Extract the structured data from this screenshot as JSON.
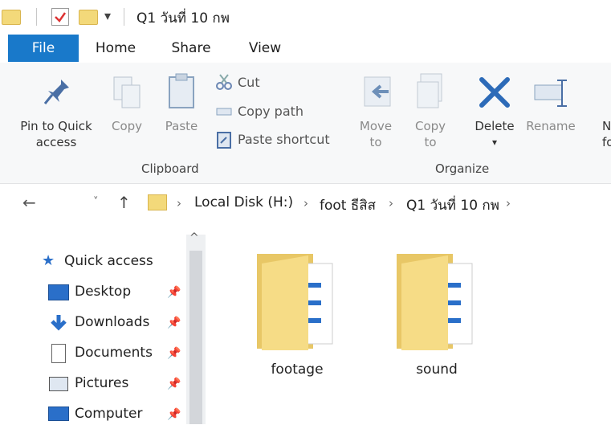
{
  "window": {
    "title": "Q1 วันที่ 10 กพ"
  },
  "tabs": [
    {
      "label": "File",
      "active": true
    },
    {
      "label": "Home"
    },
    {
      "label": "Share"
    },
    {
      "label": "View"
    }
  ],
  "ribbon": {
    "clipboard": {
      "group_label": "Clipboard",
      "pin_label_line1": "Pin to Quick",
      "pin_label_line2": "access",
      "copy_label": "Copy",
      "paste_label": "Paste",
      "cut_label": "Cut",
      "copy_path_label": "Copy path",
      "paste_shortcut_label": "Paste shortcut"
    },
    "organize": {
      "group_label": "Organize",
      "move_to_line1": "Move",
      "move_to_line2": "to",
      "copy_to_line1": "Copy",
      "copy_to_line2": "to",
      "delete_label": "Delete",
      "rename_label": "Rename",
      "new_folder_partial_line1": "N",
      "new_folder_partial_line2": "fo"
    }
  },
  "address": {
    "crumbs": [
      "Local Disk (H:)",
      "foot ธีสิส",
      "Q1 วันที่ 10 กพ"
    ]
  },
  "sidebar": {
    "items": [
      {
        "label": "Quick access",
        "icon": "star-icon",
        "pinned": false
      },
      {
        "label": "Desktop",
        "icon": "desktop-icon",
        "pinned": true
      },
      {
        "label": "Downloads",
        "icon": "download-icon",
        "pinned": true
      },
      {
        "label": "Documents",
        "icon": "documents-icon",
        "pinned": true
      },
      {
        "label": "Pictures",
        "icon": "pictures-icon",
        "pinned": true
      },
      {
        "label": "Computer",
        "icon": "computer-icon",
        "pinned": true
      }
    ]
  },
  "content": {
    "folders": [
      {
        "name": "footage"
      },
      {
        "name": "sound"
      }
    ]
  },
  "colors": {
    "accent": "#1979ca",
    "folder": "#f3d97a",
    "icon_blue": "#2a6fc9"
  }
}
